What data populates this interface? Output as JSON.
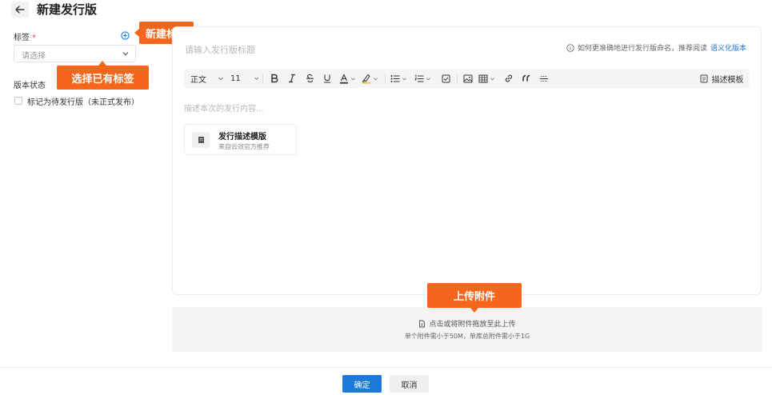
{
  "header": {
    "title": "新建发行版"
  },
  "form": {
    "tag_label": "标签",
    "required_mark": "*",
    "tag_placeholder": "请选择",
    "status_label": "版本状态",
    "prerelease_label": "标记为待发行版（未正式发布）"
  },
  "callouts": {
    "new_tag": "新建标签",
    "select_tag": "选择已有标签",
    "upload": "上传附件"
  },
  "editor": {
    "title_placeholder": "请输入发行版标题",
    "hint_text": "如何更准确地进行发行版命名，推荐阅读",
    "hint_link": "语义化版本",
    "toolbar": {
      "paragraph": "正文",
      "font_size": "11",
      "template_btn": "描述模板"
    },
    "content_placeholder": "描述本次的发行内容...",
    "template_card": {
      "title": "发行描述模版",
      "subtitle": "来自云效官方推荐"
    }
  },
  "upload": {
    "line1": "点击或将附件拖放至此上传",
    "line2": "单个附件需小于50M，单库总附件需小于1G"
  },
  "footer": {
    "confirm": "确定",
    "cancel": "取消"
  },
  "colors": {
    "accent": "#1b7bd6",
    "callout": "#f4661b",
    "required": "#e5484d"
  }
}
